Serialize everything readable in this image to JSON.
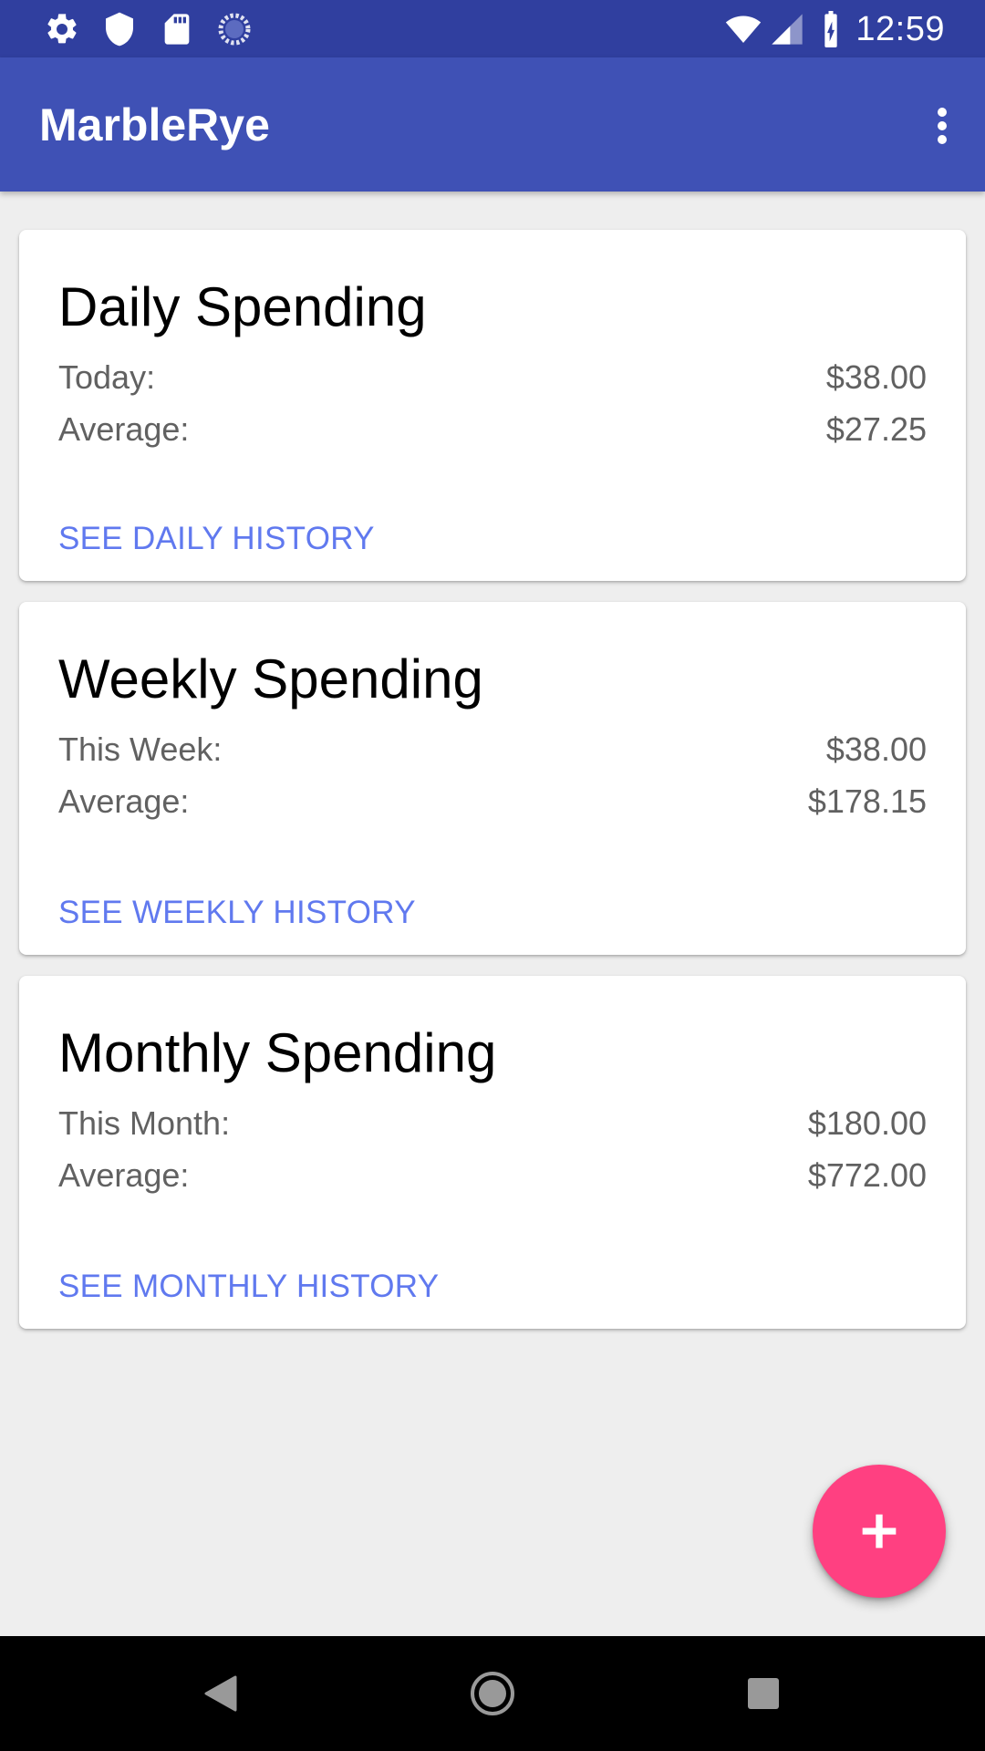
{
  "status_bar": {
    "time": "12:59",
    "left_icons": [
      "settings-icon",
      "shield-icon",
      "sd-card-icon",
      "sync-icon"
    ],
    "right_icons": [
      "wifi-icon",
      "cell-signal-icon",
      "battery-charging-icon"
    ]
  },
  "app_bar": {
    "title": "MarbleRye",
    "overflow_icon": "more-vert-icon"
  },
  "cards": {
    "daily": {
      "title": "Daily Spending",
      "row1_label": "Today:",
      "row1_value": "$38.00",
      "row2_label": "Average:",
      "row2_value": "$27.25",
      "link": "SEE DAILY HISTORY"
    },
    "weekly": {
      "title": "Weekly Spending",
      "row1_label": "This Week:",
      "row1_value": "$38.00",
      "row2_label": "Average:",
      "row2_value": "$178.15",
      "link": "SEE WEEKLY HISTORY"
    },
    "monthly": {
      "title": "Monthly Spending",
      "row1_label": "This Month:",
      "row1_value": "$180.00",
      "row2_label": "Average:",
      "row2_value": "$772.00",
      "link": "SEE MONTHLY HISTORY"
    }
  },
  "fab": {
    "icon": "plus-icon"
  },
  "nav_bar": {
    "icons": [
      "back-icon",
      "home-icon",
      "recents-icon"
    ]
  },
  "colors": {
    "status_bar": "#303f9f",
    "app_bar": "#3f51b5",
    "link": "#6079ef",
    "fab": "#ff4081",
    "background": "#eeeeee"
  }
}
